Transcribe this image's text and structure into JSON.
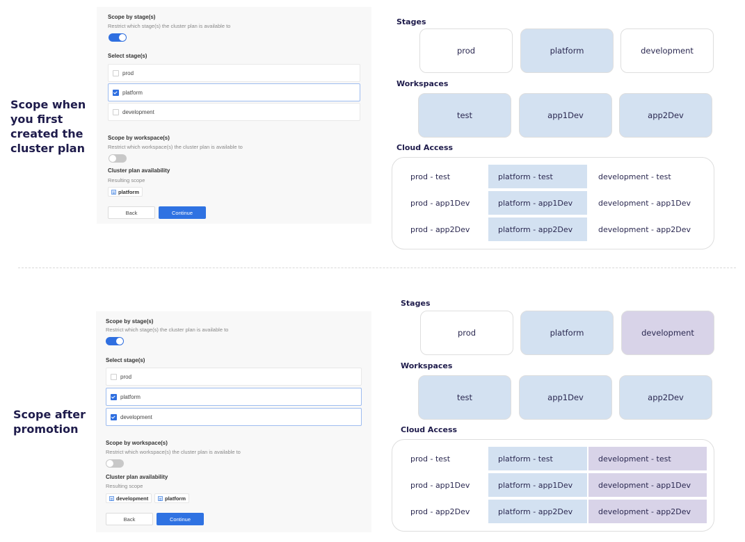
{
  "sections": [
    {
      "label": "Scope when\nyou first\ncreated the\ncluster plan",
      "form": {
        "stage_scope_title": "Scope by stage(s)",
        "stage_scope_desc": "Restrict which stage(s) the cluster plan is available to",
        "stage_toggle": "on",
        "select_stages_label": "Select stage(s)",
        "stages": [
          {
            "label": "prod",
            "checked": false
          },
          {
            "label": "platform",
            "checked": true
          },
          {
            "label": "development",
            "checked": false
          }
        ],
        "workspace_scope_title": "Scope by workspace(s)",
        "workspace_scope_desc": "Restrict which workspace(s) the cluster plan is available to",
        "workspace_toggle": "off",
        "availability_title": "Cluster plan availability",
        "availability_desc": "Resulting scope",
        "resulting_scope": [
          "platform"
        ],
        "back_label": "Back",
        "continue_label": "Continue"
      },
      "diagram": {
        "stages_label": "Stages",
        "stages": [
          {
            "label": "prod",
            "state": "unselected"
          },
          {
            "label": "platform",
            "state": "selected"
          },
          {
            "label": "development",
            "state": "unselected"
          }
        ],
        "workspaces_label": "Workspaces",
        "workspaces": [
          "test",
          "app1Dev",
          "app2Dev"
        ],
        "cloud_access_label": "Cloud Access",
        "cloud_access": [
          [
            {
              "label": "prod - test",
              "state": "none"
            },
            {
              "label": "platform - test",
              "state": "selected"
            },
            {
              "label": "development - test",
              "state": "none"
            }
          ],
          [
            {
              "label": "prod - app1Dev",
              "state": "none"
            },
            {
              "label": "platform - app1Dev",
              "state": "selected"
            },
            {
              "label": "development - app1Dev",
              "state": "none"
            }
          ],
          [
            {
              "label": "prod - app2Dev",
              "state": "none"
            },
            {
              "label": "platform - app2Dev",
              "state": "selected"
            },
            {
              "label": "development - app2Dev",
              "state": "none"
            }
          ]
        ]
      }
    },
    {
      "label": "Scope after\npromotion",
      "form": {
        "stage_scope_title": "Scope by stage(s)",
        "stage_scope_desc": "Restrict which stage(s) the cluster plan is available to",
        "stage_toggle": "on",
        "select_stages_label": "Select stage(s)",
        "stages": [
          {
            "label": "prod",
            "checked": false
          },
          {
            "label": "platform",
            "checked": true
          },
          {
            "label": "development",
            "checked": true
          }
        ],
        "workspace_scope_title": "Scope by workspace(s)",
        "workspace_scope_desc": "Restrict which workspace(s) the cluster plan is available to",
        "workspace_toggle": "off",
        "availability_title": "Cluster plan availability",
        "availability_desc": "Resulting scope",
        "resulting_scope": [
          "development",
          "platform"
        ],
        "back_label": "Back",
        "continue_label": "Continue"
      },
      "diagram": {
        "stages_label": "Stages",
        "stages": [
          {
            "label": "prod",
            "state": "unselected"
          },
          {
            "label": "platform",
            "state": "selected"
          },
          {
            "label": "development",
            "state": "promoted"
          }
        ],
        "workspaces_label": "Workspaces",
        "workspaces": [
          "test",
          "app1Dev",
          "app2Dev"
        ],
        "cloud_access_label": "Cloud Access",
        "cloud_access": [
          [
            {
              "label": "prod - test",
              "state": "none"
            },
            {
              "label": "platform - test",
              "state": "selected"
            },
            {
              "label": "development - test",
              "state": "promoted"
            }
          ],
          [
            {
              "label": "prod - app1Dev",
              "state": "none"
            },
            {
              "label": "platform - app1Dev",
              "state": "selected"
            },
            {
              "label": "development - app1Dev",
              "state": "promoted"
            }
          ],
          [
            {
              "label": "prod - app2Dev",
              "state": "none"
            },
            {
              "label": "platform - app2Dev",
              "state": "selected"
            },
            {
              "label": "development - app2Dev",
              "state": "promoted"
            }
          ]
        ]
      }
    }
  ],
  "colors": {
    "selected": "#d3e1f1",
    "promoted": "#d8d3e8",
    "accent": "#2f72e2",
    "heading": "#1e1b4b"
  }
}
